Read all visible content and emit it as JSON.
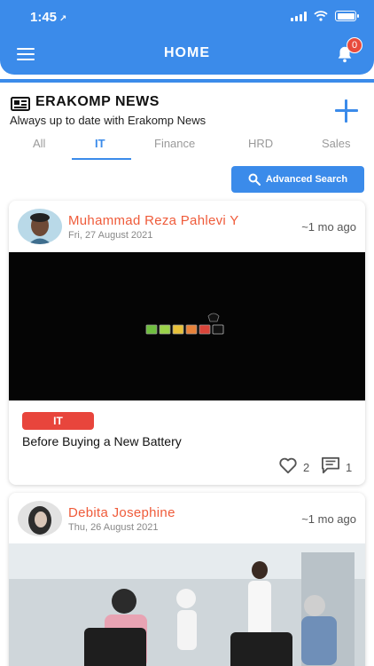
{
  "status": {
    "time": "1:45",
    "location_arrow": "↗"
  },
  "header": {
    "title": "HOME",
    "notification_count": "0"
  },
  "news": {
    "title": "ERAKOMP NEWS",
    "subtitle": "Always up to date with Erakomp News"
  },
  "tabs": [
    {
      "label": "All",
      "active": false
    },
    {
      "label": "IT",
      "active": true
    },
    {
      "label": "Finance",
      "active": false
    },
    {
      "label": "HRD",
      "active": false
    },
    {
      "label": "Sales",
      "active": false
    }
  ],
  "search": {
    "advanced_label": "Advanced Search"
  },
  "posts": [
    {
      "author": "Muhammad Reza Pahlevi Y",
      "date": "Fri, 27 August 2021",
      "ago": "~1 mo ago",
      "category": "IT",
      "title": "Before Buying a New Battery",
      "likes": "2",
      "comments": "1"
    },
    {
      "author": "Debita Josephine",
      "date": "Thu, 26 August 2021",
      "ago": "~1 mo ago"
    }
  ],
  "colors": {
    "primary": "#3b8bea",
    "accent": "#ef5b3a",
    "badge": "#e8453c"
  }
}
